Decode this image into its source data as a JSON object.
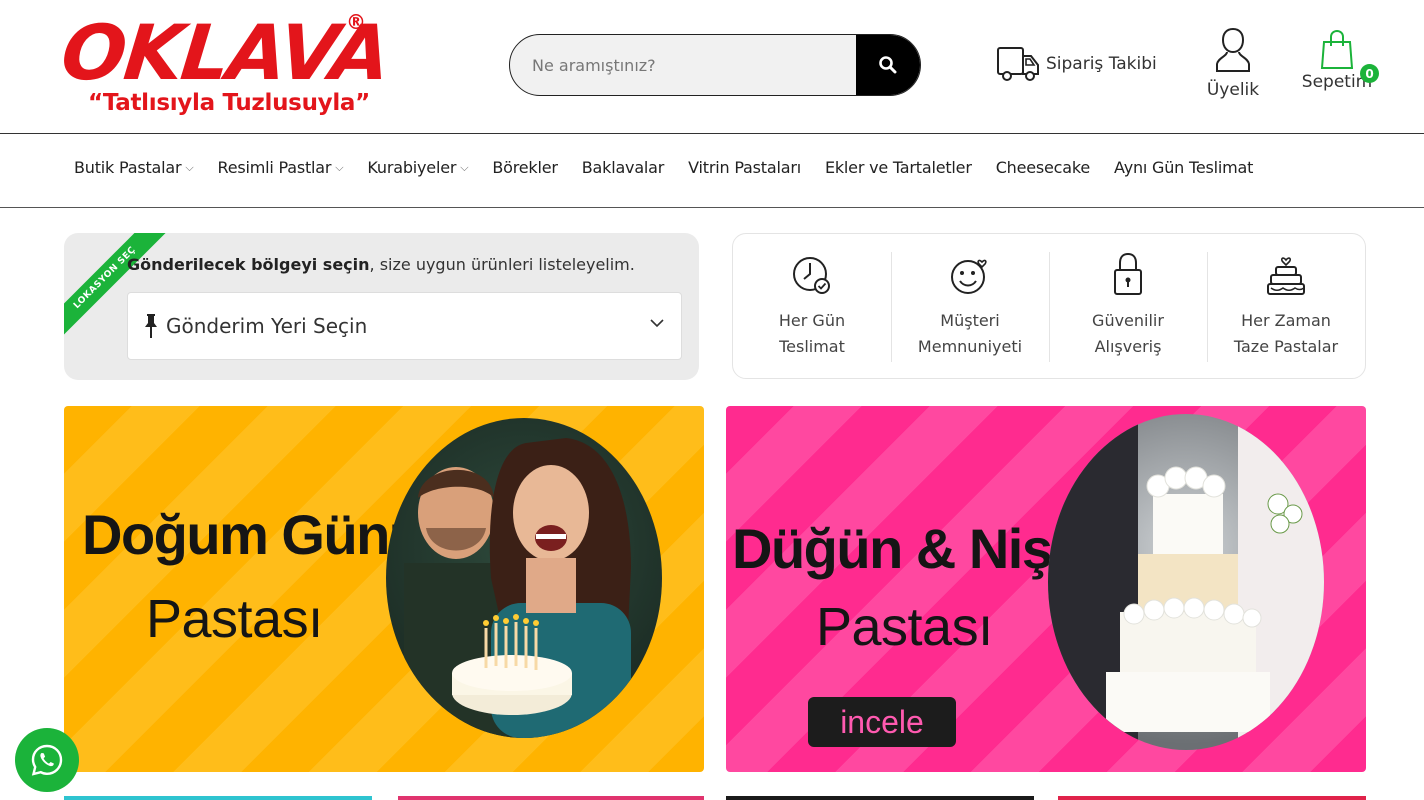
{
  "brand": {
    "name": "OKLAVA",
    "reg": "®",
    "tagline": "“Tatlısıyla Tuzlusuyla”",
    "color": "#e3151b"
  },
  "search": {
    "placeholder": "Ne aramıştınız?"
  },
  "header": {
    "order_tracking": "Sipariş Takibi",
    "membership": "Üyelik",
    "cart": "Sepetim",
    "cart_count": "0"
  },
  "nav": {
    "items": [
      {
        "label": "Butik Pastalar",
        "dropdown": true
      },
      {
        "label": "Resimli Pastlar",
        "dropdown": true
      },
      {
        "label": "Kurabiyeler",
        "dropdown": true
      },
      {
        "label": "Börekler",
        "dropdown": false
      },
      {
        "label": "Baklavalar",
        "dropdown": false
      },
      {
        "label": "Vitrin Pastaları",
        "dropdown": false
      },
      {
        "label": "Ekler ve Tartaletler",
        "dropdown": false
      },
      {
        "label": "Cheesecake",
        "dropdown": false
      },
      {
        "label": "Aynı Gün Teslimat",
        "dropdown": false
      }
    ]
  },
  "location": {
    "ribbon": "LOKASYON SEÇ",
    "prompt_bold": "Gönderilecek bölgeyi seçin",
    "prompt_rest": ", size uygun ürünleri listeleyelim.",
    "select_value": "Gönderim Yeri Seçin"
  },
  "features": [
    {
      "icon": "clock-check-icon",
      "line1": "Her Gün",
      "line2": "Teslimat"
    },
    {
      "icon": "smiley-heart-icon",
      "line1": "Müşteri",
      "line2": "Memnuniyeti"
    },
    {
      "icon": "lock-icon",
      "line1": "Güvenilir",
      "line2": "Alışveriş"
    },
    {
      "icon": "cake-icon",
      "line1": "Her Zaman",
      "line2": "Taze Pastalar"
    }
  ],
  "banners": [
    {
      "title": "Doğum Günü",
      "subtitle": "Pastası",
      "color": "#ffb300"
    },
    {
      "title": "Düğün & Nişan",
      "subtitle": "Pastası",
      "button": "incele",
      "color": "#ff2b8f"
    }
  ],
  "colors": {
    "accent_green": "#1bb33a",
    "black": "#000000"
  }
}
